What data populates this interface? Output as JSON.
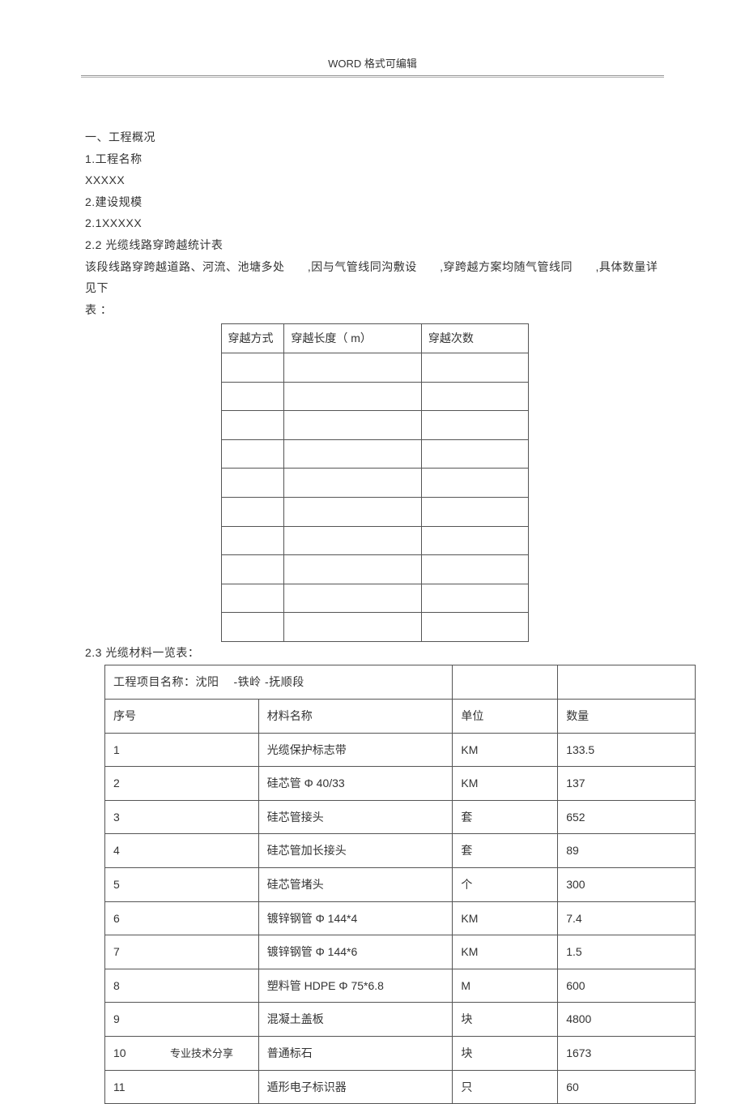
{
  "header": {
    "text": "WORD 格式可编辑"
  },
  "footer": {
    "text": "专业技术分享"
  },
  "body": {
    "section1_title": "一、工程概况",
    "s1_1_label": "1.工程名称",
    "s1_1_value": "XXXXX",
    "s1_2_label": "2.建设规模",
    "s1_2_1": "2.1XXXXX",
    "s1_2_2_title": "2.2 光缆线路穿跨越统计表",
    "s1_2_2_para_a": "该段线路穿跨越道路、河流、池塘多处",
    "s1_2_2_para_b": " ,因与气管线同沟敷设",
    "s1_2_2_para_c": " ,穿跨越方案均随气管线同",
    "s1_2_2_para_d": " ,具体数量详见下",
    "s1_2_2_para_e": "表 ：",
    "s1_2_3_title": "2.3 光缆材料一览表："
  },
  "table1": {
    "headers": {
      "c1": "穿越方式",
      "c2": "穿越长度（ m）",
      "c3": "穿越次数"
    },
    "rowCount": 10
  },
  "table2": {
    "project_label": "工程项目名称：沈阳",
    "project_suffix": "-铁岭 -抚顺段",
    "headers": {
      "c1": "序号",
      "c2": "材料名称",
      "c3": "单位",
      "c4": "数量"
    },
    "rows": [
      {
        "no": "1",
        "name": "光缆保护标志带",
        "unit": "KM",
        "qty": "133.5"
      },
      {
        "no": "2",
        "name": "硅芯管 Φ 40/33",
        "unit": "KM",
        "qty": "137"
      },
      {
        "no": "3",
        "name": "硅芯管接头",
        "unit": "套",
        "qty": "652"
      },
      {
        "no": "4",
        "name": "硅芯管加长接头",
        "unit": "套",
        "qty": "89"
      },
      {
        "no": "5",
        "name": "硅芯管堵头",
        "unit": "个",
        "qty": "300"
      },
      {
        "no": "6",
        "name": "镀锌钢管 Φ 144*4",
        "unit": "KM",
        "qty": "7.4"
      },
      {
        "no": "7",
        "name": "镀锌钢管 Φ 144*6",
        "unit": "KM",
        "qty": "1.5"
      },
      {
        "no": "8",
        "name": "塑料管 HDPE Φ 75*6.8",
        "unit": "M",
        "qty": "600"
      },
      {
        "no": "9",
        "name": "混凝土盖板",
        "unit": "块",
        "qty": "4800"
      },
      {
        "no": "10",
        "name": "普通标石",
        "unit": "块",
        "qty": "1673"
      },
      {
        "no": "11",
        "name": "遁形电子标识器",
        "unit": "只",
        "qty": "60"
      }
    ]
  }
}
